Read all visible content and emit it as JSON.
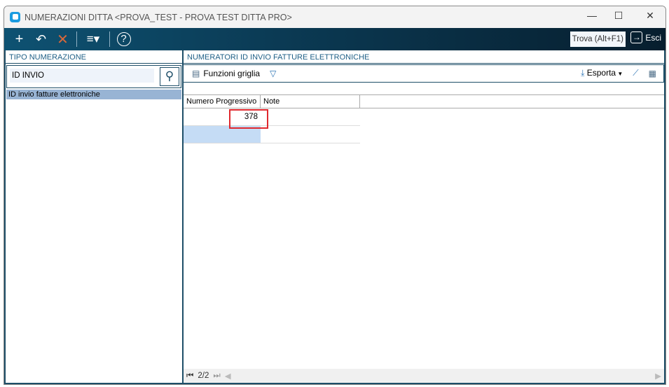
{
  "window": {
    "title": "NUMERAZIONI DITTA <PROVA_TEST - PROVA TEST DITTA PRO>"
  },
  "toolbar": {
    "trova": "Trova (Alt+F1)",
    "esci": "Esci"
  },
  "left": {
    "header": "TIPO NUMERAZIONE",
    "search_value": "ID INVIO",
    "items": [
      "ID invio fatture elettroniche"
    ]
  },
  "right": {
    "header": "NUMERATORI ID INVIO FATTURE ELETTRONICHE",
    "funzioni": "Funzioni griglia",
    "esporta": "Esporta",
    "columns": [
      "Numero Progressivo",
      "Note"
    ],
    "rows": [
      [
        "378",
        ""
      ]
    ],
    "pager": "2/2"
  },
  "colors": {
    "toolbar": "#0b3b55",
    "highlight": "#e0282e",
    "selection": "#98b4d4"
  }
}
